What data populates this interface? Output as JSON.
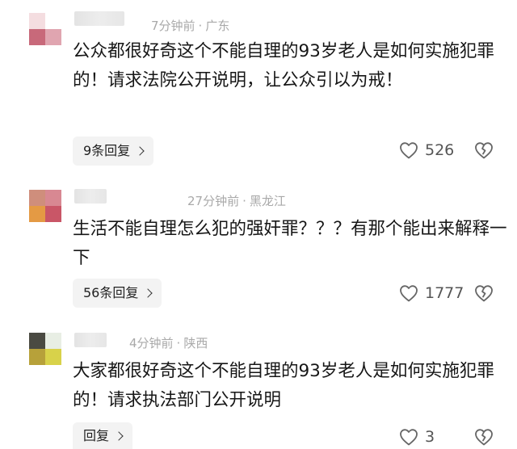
{
  "comments": [
    {
      "avatar_colors": [
        "#f4dde0",
        "#ffffff",
        "#c8697a",
        "#e0a5b0"
      ],
      "time": "7分钟前",
      "location": "广东",
      "text": "公众都很好奇这个不能自理的93岁老人是如何实施犯罪的！请求法院公开说明，让公众引以为戒！",
      "reply_label": "9条回复",
      "likes": "526"
    },
    {
      "avatar_colors": [
        "#cf8e7c",
        "#d88892",
        "#e49a44",
        "#c95667"
      ],
      "time": "27分钟前",
      "location": "黑龙江",
      "text": "生活不能自理怎么犯的强奸罪？？？有那个能出来解释一下",
      "reply_label": "56条回复",
      "likes": "1777"
    },
    {
      "avatar_colors": [
        "#4a4a42",
        "#e8eee4",
        "#b7a13a",
        "#d8d24a"
      ],
      "time": "4分钟前",
      "location": "陕西",
      "text": "大家都很好奇这个不能自理的93岁老人是如何实施犯罪的！请求执法部门公开说明",
      "reply_label": "回复",
      "likes": "3"
    }
  ],
  "icons": {
    "like": "heart-outline-icon",
    "dislike": "broken-heart-icon",
    "reply_arrow": "chevron-right-icon"
  }
}
